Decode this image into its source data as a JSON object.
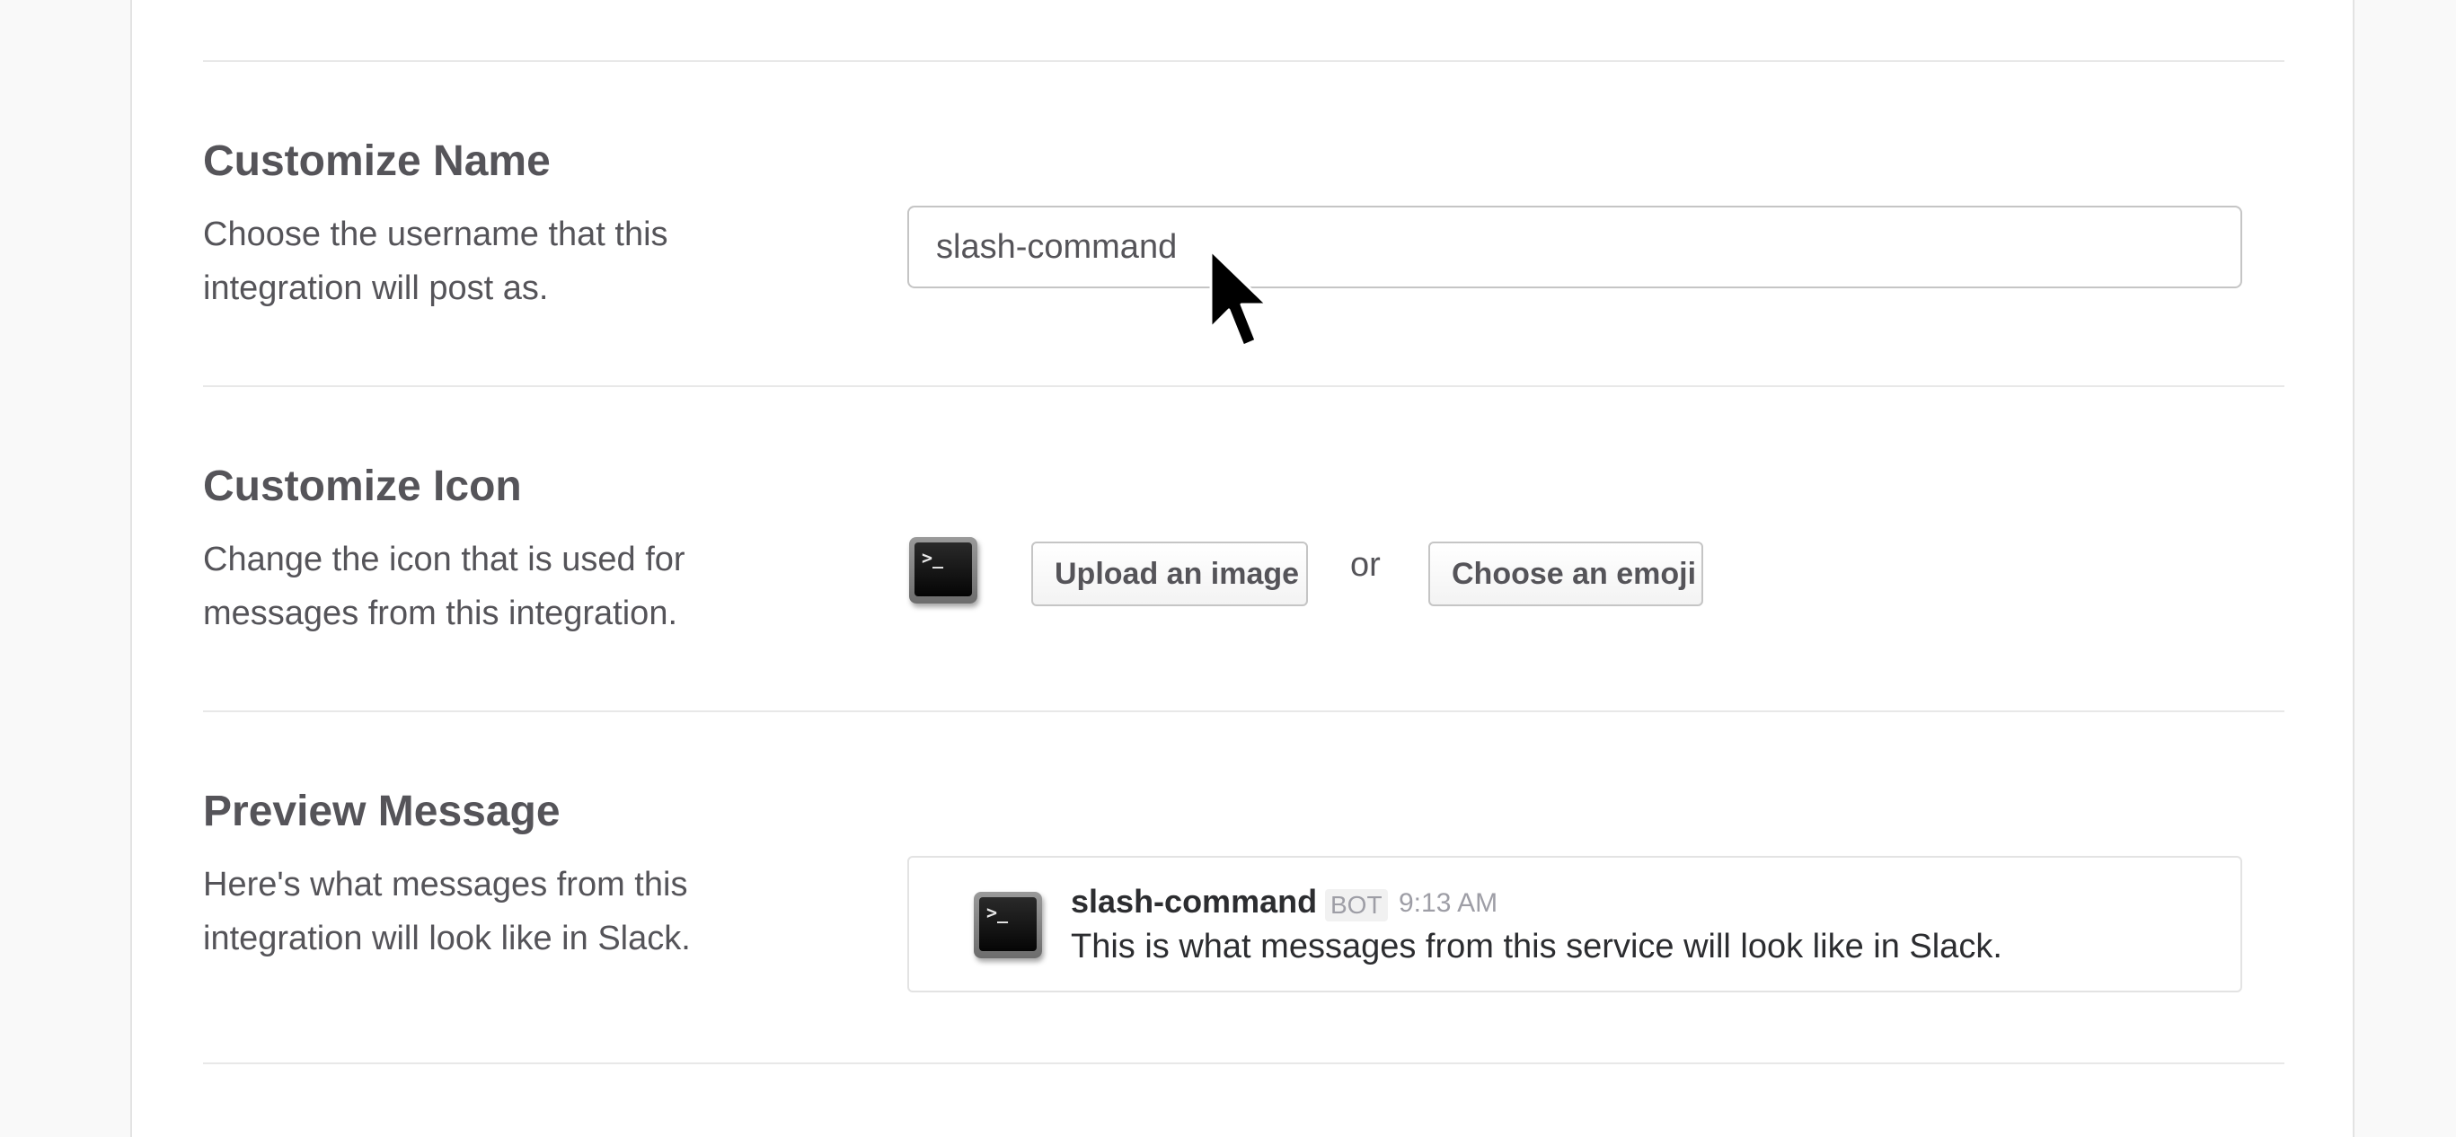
{
  "sections": {
    "name": {
      "title": "Customize Name",
      "description": "Choose the username that this integration will post as.",
      "input_value": "slash-command"
    },
    "icon": {
      "title": "Customize Icon",
      "description": "Change the icon that is used for messages from this integration.",
      "upload_label": "Upload an image",
      "or_label": "or",
      "emoji_label": "Choose an emoji",
      "icon_name": "terminal-icon",
      "icon_glyph": ">_"
    },
    "preview": {
      "title": "Preview Message",
      "description": "Here's what messages from this integration will look like in Slack.",
      "username": "slash-command",
      "badge": "BOT",
      "time": "9:13 AM",
      "message": "This is what messages from this service will look like in Slack.",
      "icon_name": "terminal-icon",
      "icon_glyph": ">_"
    }
  },
  "colors": {
    "text": "#555459",
    "message_text": "#2c2d30",
    "muted": "#9e9ea6",
    "border": "#c5c5c5",
    "divider": "#e8e8e8"
  }
}
